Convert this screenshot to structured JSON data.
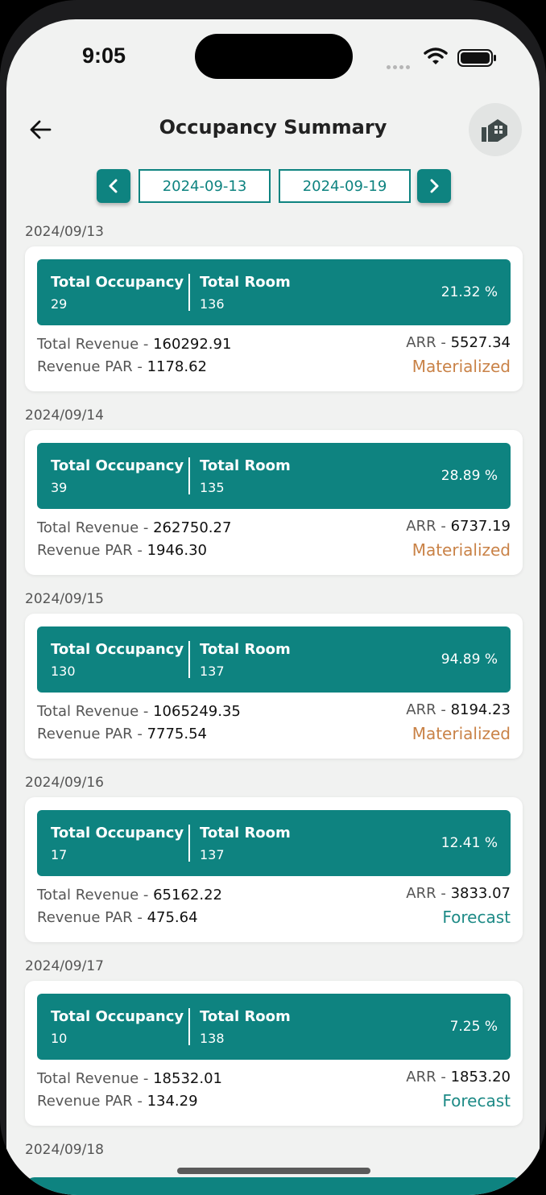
{
  "status_bar": {
    "time": "9:05"
  },
  "header": {
    "title": "Occupancy Summary"
  },
  "date_range": {
    "start": "2024-09-13",
    "end": "2024-09-19"
  },
  "labels": {
    "total_occupancy": "Total Occupancy",
    "total_room": "Total Room",
    "total_revenue": "Total Revenue - ",
    "revenue_par": "Revenue PAR - ",
    "arr": "ARR - "
  },
  "colors": {
    "accent": "#0e8380",
    "materialized": "#c98247",
    "forecast": "#1d8a86",
    "background": "#f1f2f1"
  },
  "days": [
    {
      "date": "2024/09/13",
      "occupancy": "29",
      "rooms": "136",
      "percent": "21.32 %",
      "revenue": "160292.91",
      "revpar": "1178.62",
      "arr": "5527.34",
      "status": "Materialized"
    },
    {
      "date": "2024/09/14",
      "occupancy": "39",
      "rooms": "135",
      "percent": "28.89 %",
      "revenue": "262750.27",
      "revpar": "1946.30",
      "arr": "6737.19",
      "status": "Materialized"
    },
    {
      "date": "2024/09/15",
      "occupancy": "130",
      "rooms": "137",
      "percent": "94.89 %",
      "revenue": "1065249.35",
      "revpar": "7775.54",
      "arr": "8194.23",
      "status": "Materialized"
    },
    {
      "date": "2024/09/16",
      "occupancy": "17",
      "rooms": "137",
      "percent": "12.41 %",
      "revenue": "65162.22",
      "revpar": "475.64",
      "arr": "3833.07",
      "status": "Forecast"
    },
    {
      "date": "2024/09/17",
      "occupancy": "10",
      "rooms": "138",
      "percent": "7.25 %",
      "revenue": "18532.01",
      "revpar": "134.29",
      "arr": "1853.20",
      "status": "Forecast"
    },
    {
      "date": "2024/09/18"
    }
  ]
}
